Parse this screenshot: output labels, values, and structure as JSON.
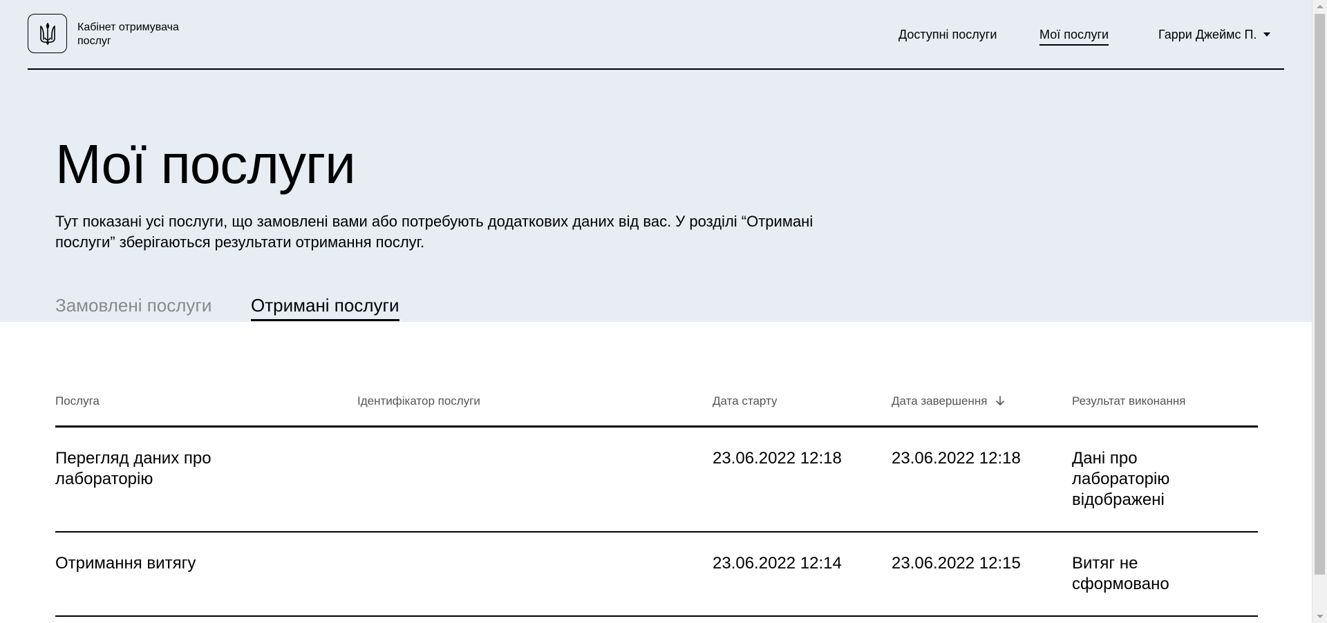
{
  "header": {
    "logo_text": "Кабінет отримувача послуг",
    "nav": {
      "available": "Доступні послуги",
      "my": "Мої послуги"
    },
    "user_name": "Гарри Джеймс П."
  },
  "hero": {
    "title": "Мої послуги",
    "description": "Тут показані усі послуги, що замовлені вами або потребують додаткових даних від вас. У розділі “Отримані послуги” зберігаються результати отримання послуг.",
    "tabs": {
      "ordered": "Замовлені послуги",
      "received": "Отримані послуги"
    },
    "active_tab": "received"
  },
  "table": {
    "headers": {
      "service": "Послуга",
      "service_id": "Ідентифікатор послуги",
      "start_date": "Дата старту",
      "end_date": "Дата завершення",
      "result": "Результат виконання"
    },
    "sort_column": "end_date",
    "sort_direction": "desc",
    "rows": [
      {
        "service": "Перегляд даних про лабораторію",
        "service_id": "",
        "start_date": "23.06.2022 12:18",
        "end_date": "23.06.2022 12:18",
        "result": "Дані про лабораторію відображені"
      },
      {
        "service": "Отримання витягу",
        "service_id": "",
        "start_date": "23.06.2022 12:14",
        "end_date": "23.06.2022 12:15",
        "result": "Витяг не сформовано"
      }
    ]
  },
  "colors": {
    "hero_background": "#e7edf3",
    "inactive_tab": "#8a8a8a",
    "header_text": "#555555"
  },
  "icons": {
    "logo": "trident-icon",
    "user_dropdown": "caret-down-icon",
    "sort": "arrow-down-icon"
  }
}
